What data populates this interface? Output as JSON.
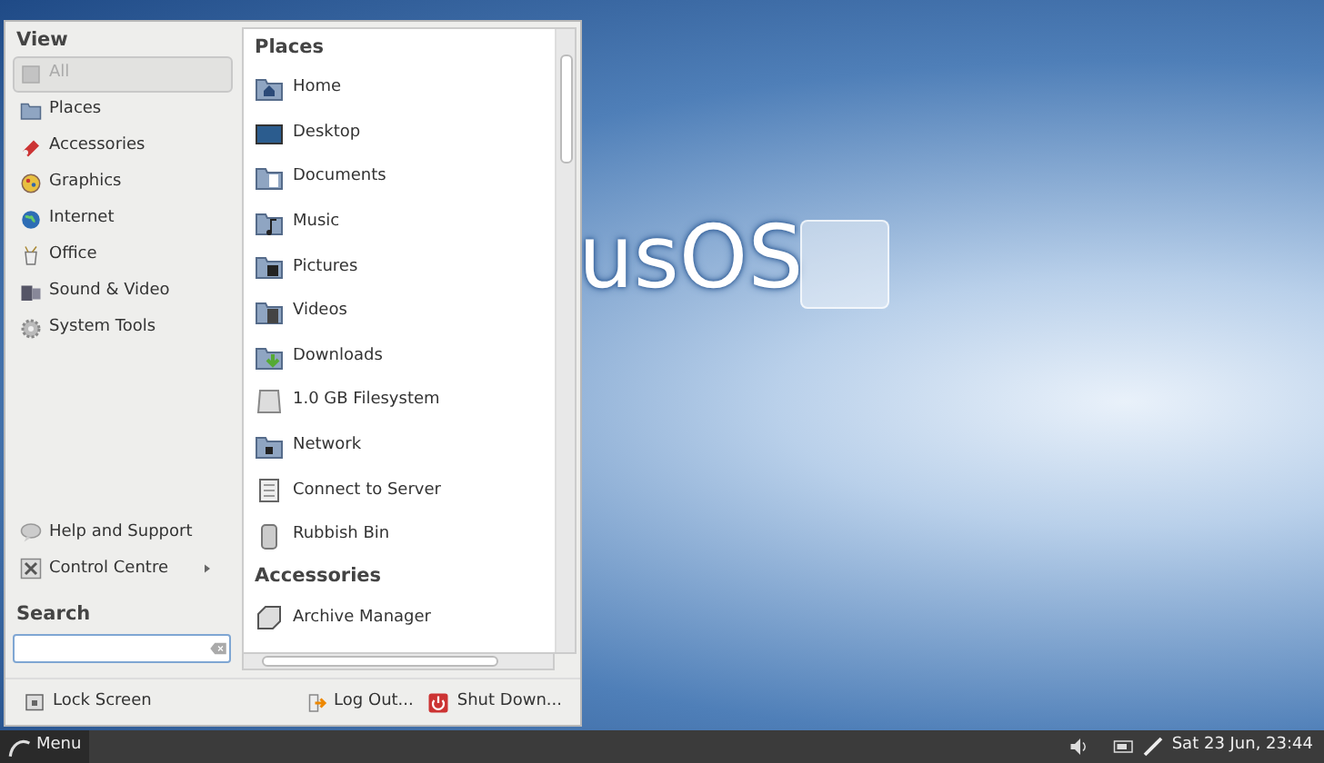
{
  "wallpaper": {
    "logo_text": "usOS"
  },
  "menu": {
    "view_heading": "View",
    "categories": [
      {
        "label": "All",
        "selected": true
      },
      {
        "label": "Places",
        "selected": false
      },
      {
        "label": "Accessories",
        "selected": false
      },
      {
        "label": "Graphics",
        "selected": false
      },
      {
        "label": "Internet",
        "selected": false
      },
      {
        "label": "Office",
        "selected": false
      },
      {
        "label": "Sound & Video",
        "selected": false
      },
      {
        "label": "System Tools",
        "selected": false
      }
    ],
    "extra_items": [
      {
        "label": "Help and Support",
        "has_submenu": false
      },
      {
        "label": "Control Centre",
        "has_submenu": true
      }
    ],
    "search": {
      "heading": "Search"
    },
    "sections": [
      {
        "heading": "Places",
        "items": [
          "Home",
          "Desktop",
          "Documents",
          "Music",
          "Pictures",
          "Videos",
          "Downloads",
          "1.0 GB Filesystem",
          "Network",
          "Connect to Server",
          "Rubbish Bin"
        ]
      },
      {
        "heading": "Accessories",
        "items": [
          "Archive Manager"
        ]
      }
    ],
    "actions": [
      "Lock Screen",
      "Log Out...",
      "Shut Down..."
    ]
  },
  "taskbar": {
    "menu_button": "Menu",
    "clock": "Sat 23 Jun, 23:44"
  }
}
